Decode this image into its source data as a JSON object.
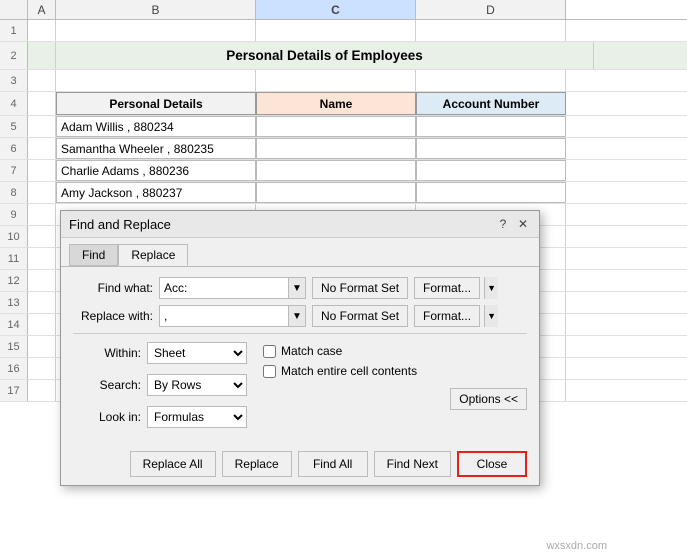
{
  "spreadsheet": {
    "col_headers": [
      "",
      "A",
      "B",
      "C",
      "D"
    ],
    "title": "Personal Details of Employees",
    "headers": {
      "col_b": "Personal Details",
      "col_c": "Name",
      "col_d": "Account Number"
    },
    "rows": [
      {
        "num": "1",
        "b": "",
        "c": "",
        "d": ""
      },
      {
        "num": "2",
        "b": "Personal Details of Employees",
        "c": "",
        "d": ""
      },
      {
        "num": "3",
        "b": "",
        "c": "",
        "d": ""
      },
      {
        "num": "4",
        "b": "Personal Details",
        "c": "Name",
        "d": "Account Number"
      },
      {
        "num": "5",
        "b": "Adam Willis , 880234",
        "c": "",
        "d": ""
      },
      {
        "num": "6",
        "b": "Samantha Wheeler , 880235",
        "c": "",
        "d": ""
      },
      {
        "num": "7",
        "b": "Charlie Adams , 880236",
        "c": "",
        "d": ""
      },
      {
        "num": "8",
        "b": "Amy Jackson , 880237",
        "c": "",
        "d": ""
      },
      {
        "num": "9",
        "b": "",
        "c": "",
        "d": ""
      }
    ]
  },
  "dialog": {
    "title": "Find and Replace",
    "help_symbol": "?",
    "close_symbol": "✕",
    "tabs": [
      "Find",
      "Replace"
    ],
    "active_tab": "Replace",
    "find_label": "Find what:",
    "find_value": "Acc:",
    "replace_label": "Replace with:",
    "replace_value": ",",
    "no_format_label1": "No Format Set",
    "no_format_label2": "No Format Set",
    "format_btn_label": "Format...",
    "within_label": "Within:",
    "within_value": "Sheet",
    "search_label": "Search:",
    "search_value": "By Rows",
    "lookin_label": "Look in:",
    "lookin_value": "Formulas",
    "match_case_label": "Match case",
    "match_cell_label": "Match entire cell contents",
    "options_btn": "Options <<",
    "footer_btns": [
      "Replace All",
      "Replace",
      "Find All",
      "Find Next",
      "Close"
    ]
  },
  "watermark": "wxsxdn.com"
}
